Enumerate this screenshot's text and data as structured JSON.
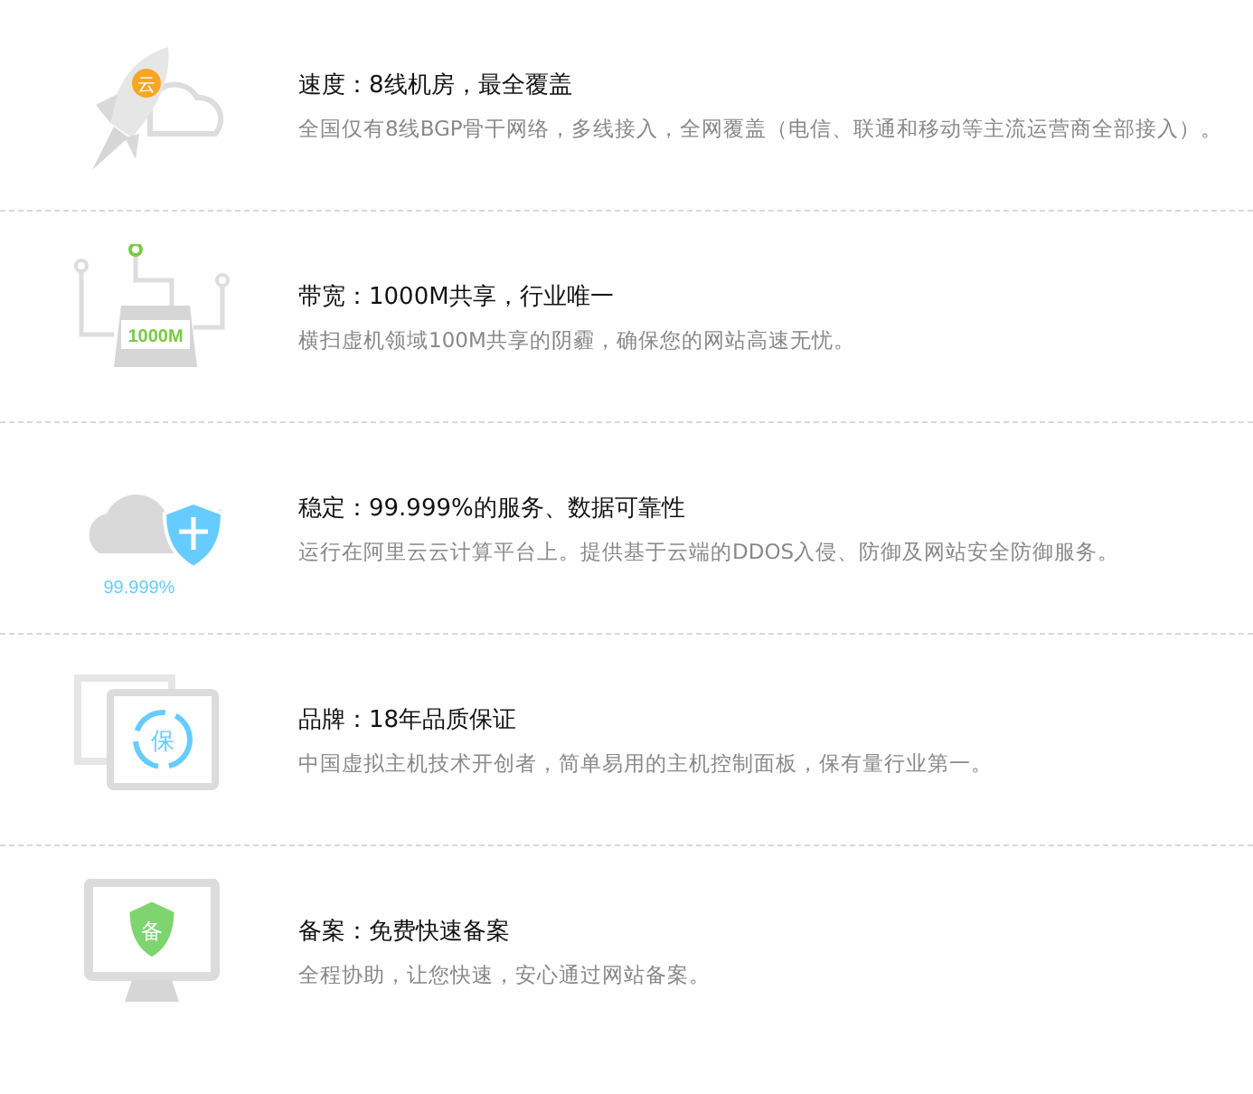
{
  "features": [
    {
      "kind": "rocket",
      "icon_text": "云",
      "title": "速度：8线机房，最全覆盖",
      "description": "全国仅有8线BGP骨干网络，多线接入，全网覆盖（电信、联通和移动等主流运营商全部接入）。"
    },
    {
      "kind": "server",
      "icon_text": "1000M",
      "title": "带宽：1000M共享，行业唯一",
      "description": "横扫虚机领域100M共享的阴霾，确保您的网站高速无忧。"
    },
    {
      "kind": "cloud",
      "icon_text": "99.999%",
      "title": "稳定：99.999%的服务、数据可靠性",
      "description": "运行在阿里云云计算平台上。提供基于云端的DDOS入侵、防御及网站安全防御服务。"
    },
    {
      "kind": "brand",
      "icon_text": "保",
      "title": "品牌：18年品质保证",
      "description": "中国虚拟主机技术开创者，简单易用的主机控制面板，保有量行业第一。"
    },
    {
      "kind": "record",
      "icon_text": "备",
      "title": "备案：免费快速备案",
      "description": "全程协助，让您快速，安心通过网站备案。"
    }
  ]
}
